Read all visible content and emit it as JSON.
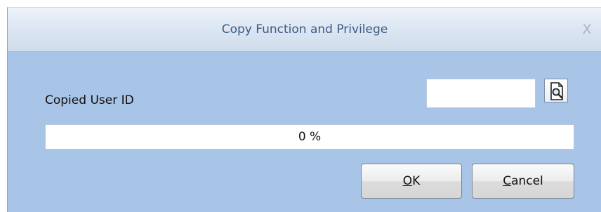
{
  "window": {
    "title": "Copy Function and Privilege",
    "close_label": "X"
  },
  "form": {
    "copied_user_id_label": "Copied User ID",
    "copied_user_id_value": "",
    "lookup_icon": "lookup-magnifier-icon"
  },
  "progress": {
    "value_fraction": 0,
    "text": "0 %"
  },
  "buttons": {
    "ok": {
      "mnemonic": "O",
      "rest": "K"
    },
    "cancel": {
      "mnemonic": "C",
      "rest": "ancel"
    }
  },
  "colors": {
    "dialog_background": "#a8c4e6",
    "title_text": "#3b5a86",
    "close_glyph": "#a9b3c0"
  }
}
